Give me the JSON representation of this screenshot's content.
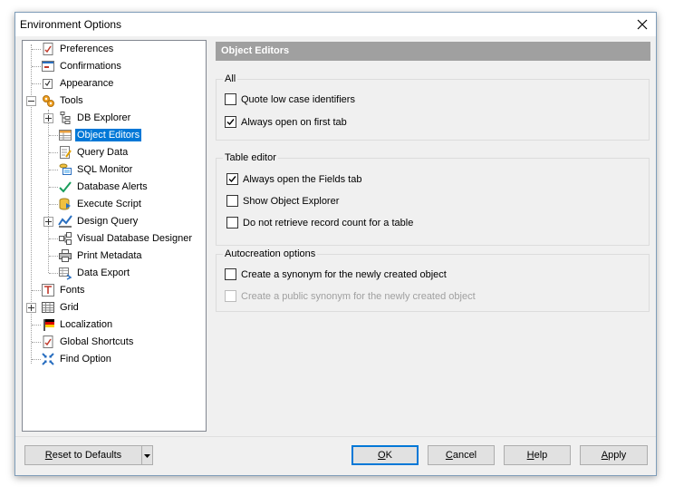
{
  "window": {
    "title": "Environment Options"
  },
  "tree": {
    "items": [
      {
        "label": "Preferences",
        "icon": "preferences-icon"
      },
      {
        "label": "Confirmations",
        "icon": "confirmations-icon"
      },
      {
        "label": "Appearance",
        "icon": "appearance-icon"
      },
      {
        "label": "Tools",
        "icon": "tools-icon"
      },
      {
        "label": "DB Explorer",
        "icon": "db-explorer-icon"
      },
      {
        "label": "Object Editors",
        "icon": "object-editors-icon"
      },
      {
        "label": "Query Data",
        "icon": "query-data-icon"
      },
      {
        "label": "SQL Monitor",
        "icon": "sql-monitor-icon"
      },
      {
        "label": "Database Alerts",
        "icon": "check-icon"
      },
      {
        "label": "Execute Script",
        "icon": "execute-script-icon"
      },
      {
        "label": "Design Query",
        "icon": "design-query-icon"
      },
      {
        "label": "Visual Database Designer",
        "icon": "visual-designer-icon"
      },
      {
        "label": "Print Metadata",
        "icon": "printer-icon"
      },
      {
        "label": "Data Export",
        "icon": "data-export-icon"
      },
      {
        "label": "Fonts",
        "icon": "fonts-icon"
      },
      {
        "label": "Grid",
        "icon": "grid-icon"
      },
      {
        "label": "Localization",
        "icon": "localization-icon"
      },
      {
        "label": "Global Shortcuts",
        "icon": "shortcuts-icon"
      },
      {
        "label": "Find Option",
        "icon": "find-option-icon"
      }
    ],
    "selected": "Object Editors"
  },
  "panel": {
    "title": "Object Editors",
    "groups": [
      {
        "title": "All",
        "options": [
          {
            "label": "Quote low case identifiers",
            "checked": false,
            "enabled": true
          },
          {
            "label": "Always open on first tab",
            "checked": true,
            "enabled": true
          }
        ]
      },
      {
        "title": "Table editor",
        "options": [
          {
            "label": "Always open the Fields tab",
            "checked": true,
            "enabled": true
          },
          {
            "label": "Show Object Explorer",
            "checked": false,
            "enabled": true
          },
          {
            "label": "Do not retrieve record count for a table",
            "checked": false,
            "enabled": true
          }
        ]
      },
      {
        "title": "Autocreation options",
        "options": [
          {
            "label": "Create a synonym for the newly created object",
            "checked": false,
            "enabled": true
          },
          {
            "label": "Create a public synonym for the newly created object",
            "checked": false,
            "enabled": false
          }
        ]
      }
    ]
  },
  "buttons": {
    "reset": {
      "mnemonic": "R",
      "rest": "eset to Defaults"
    },
    "ok": {
      "mnemonic": "O",
      "rest": "K"
    },
    "cancel": {
      "mnemonic": "C",
      "rest": "ancel"
    },
    "help": {
      "mnemonic": "H",
      "rest": "elp"
    },
    "apply": {
      "mnemonic": "A",
      "rest": "pply"
    }
  },
  "colors": {
    "selection": "#0078d7",
    "header": "#a0a0a0",
    "accent_check": "#1a9e5c"
  }
}
